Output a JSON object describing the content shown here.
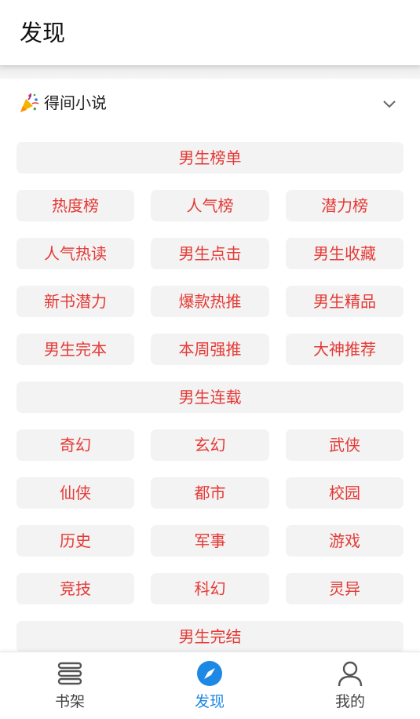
{
  "header": {
    "title": "发现"
  },
  "source": {
    "name": "得间小说"
  },
  "sections": [
    {
      "title": "男生榜单",
      "items": [
        "热度榜",
        "人气榜",
        "潜力榜",
        "人气热读",
        "男生点击",
        "男生收藏",
        "新书潜力",
        "爆款热推",
        "男生精品",
        "男生完本",
        "本周强推",
        "大神推荐"
      ]
    },
    {
      "title": "男生连载",
      "items": [
        "奇幻",
        "玄幻",
        "武侠",
        "仙侠",
        "都市",
        "校园",
        "历史",
        "军事",
        "游戏",
        "竞技",
        "科幻",
        "灵异"
      ]
    },
    {
      "title": "男生完结",
      "items": []
    }
  ],
  "nav": [
    {
      "label": "书架",
      "icon": "bookshelf-icon",
      "active": false
    },
    {
      "label": "发现",
      "icon": "compass-icon",
      "active": true
    },
    {
      "label": "我的",
      "icon": "user-icon",
      "active": false
    }
  ],
  "colors": {
    "accent": "#1e88e5",
    "chip_text": "#e53935",
    "chip_bg": "#f3f3f3"
  }
}
